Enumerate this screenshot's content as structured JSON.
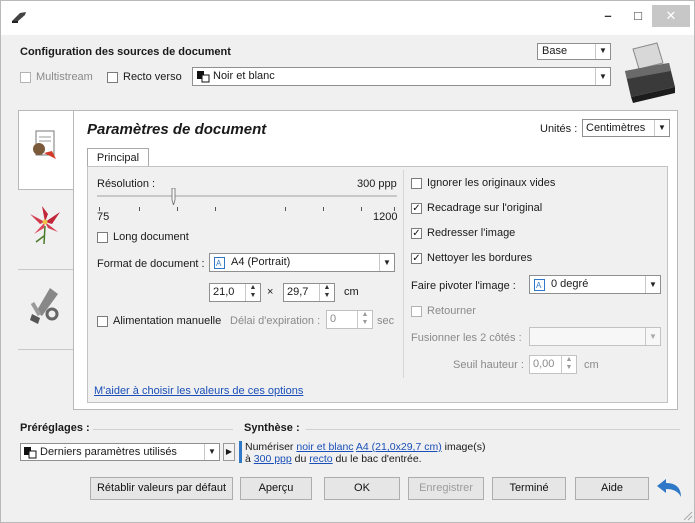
{
  "window": {
    "minimize": "–",
    "maximize": "□",
    "close": "✕"
  },
  "source_config": {
    "title": "Configuration des sources de document",
    "mode": "Base",
    "multistream": "Multistream",
    "recto_verso": "Recto verso",
    "color_mode": "Noir et blanc"
  },
  "document": {
    "title": "Paramètres de document",
    "units_label": "Unités :",
    "units_value": "Centimètres",
    "tab": "Principal",
    "resolution_label": "Résolution :",
    "resolution_value": "300 ppp",
    "resolution_min": "75",
    "resolution_max": "1200",
    "resolution_fraction": 0.25,
    "long_document": "Long document",
    "format_label": "Format de document :",
    "format_value": "A4 (Portrait)",
    "width": "21,0",
    "times": "×",
    "height": "29,7",
    "unit_cm": "cm",
    "manual_feed": "Alimentation manuelle",
    "timeout_label": "Délai d'expiration :",
    "timeout_value": "0",
    "timeout_unit": "sec",
    "help_link": "M'aider à choisir les valeurs de ces options"
  },
  "options": {
    "ignore_blank": "Ignorer les originaux vides",
    "crop": "Recadrage sur l'original",
    "straighten": "Redresser l'image",
    "clean_borders": "Nettoyer les bordures",
    "rotate_label": "Faire pivoter l'image :",
    "rotate_value": "0 degré",
    "flip": "Retourner",
    "merge_label": "Fusionner les 2 côtés :",
    "merge_value": "",
    "threshold_label": "Seuil hauteur :",
    "threshold_value": "0,00",
    "threshold_unit": "cm"
  },
  "checks": {
    "multistream": false,
    "recto_verso": false,
    "long_document": false,
    "manual_feed": false,
    "ignore_blank": false,
    "crop": true,
    "straighten": true,
    "clean_borders": true,
    "flip": false
  },
  "presets": {
    "label": "Préréglages :",
    "value": "Derniers paramètres utilisés"
  },
  "summary": {
    "label": "Synthèse :",
    "t1": "Numériser",
    "l1": "noir et blanc",
    "l2": "A4 (21,0x29,7 cm)",
    "t2": "image(s)",
    "t3": "à",
    "l3": "300 ppp",
    "t4": "du",
    "l4": "recto",
    "t5": "du le bac d'entrée."
  },
  "buttons": {
    "reset": "Rétablir valeurs par défaut",
    "preview": "Aperçu",
    "ok": "OK",
    "save": "Enregistrer",
    "done": "Terminé",
    "help": "Aide"
  },
  "icons": {
    "app": "scanner-app-icon",
    "scanner": "scanner-device-icon",
    "doc_settings": "document-settings-icon",
    "image_settings": "flower-image-icon",
    "tools": "tools-icon",
    "back": "back-arrow-icon"
  },
  "colors": {
    "link": "#1a4fb8",
    "accent_blue": "#2f78c8"
  }
}
